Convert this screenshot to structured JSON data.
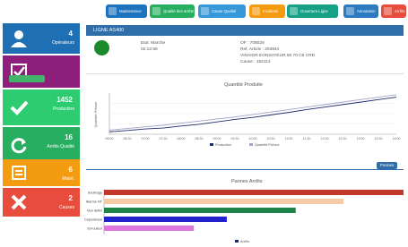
{
  "toolbar": [
    {
      "label": "Maintenance",
      "color": "#1e73be"
    },
    {
      "label": "Qualité des arrêts",
      "color": "#27ae60"
    },
    {
      "label": "Cause Qualité",
      "color": "#3498db"
    },
    {
      "label": "Incidents",
      "color": "#f39c12"
    },
    {
      "label": "Ouverture Ligne",
      "color": "#16a085"
    },
    {
      "label": "Annotation",
      "color": "#2c7bc1"
    },
    {
      "label": "Arrêts",
      "color": "#e74c3c"
    }
  ],
  "sidebar": [
    {
      "value": "4",
      "label": "Opérateurs",
      "icon": "user-icon",
      "color": "#1e6fb3"
    },
    {
      "value": "",
      "label": "",
      "icon": "checklist-icon",
      "color": "#8e1e7c"
    },
    {
      "value": "1452",
      "label": "Production",
      "icon": "check-icon",
      "color": "#2ecc71"
    },
    {
      "value": "16",
      "label": "Arrêts Qualité",
      "icon": "refresh-icon",
      "color": "#27ae60"
    },
    {
      "value": "6",
      "label": "Maint.",
      "icon": "card-icon",
      "color": "#f39c12"
    },
    {
      "value": "2",
      "label": "Causes",
      "icon": "cross-icon",
      "color": "#e74c3c"
    }
  ],
  "header": {
    "title": "LIGNE AS400",
    "status_label": "Etat: Marche",
    "status_time": "02:12:56",
    "of": "OF : 708029",
    "ref": "Ref. Article : 203944",
    "product": "VINAIGR EONSATEUR 50 70 C6 CRD",
    "cause": "Cause : 182113"
  },
  "production_chart": {
    "title": "Quantité Produite",
    "ylabel": "Quantité Prévue",
    "xlabels": [
      "06:00",
      "06:30",
      "07:00",
      "07:30",
      "08:00",
      "08:30",
      "09:00",
      "09:30",
      "10:00",
      "10:30",
      "11:00",
      "11:30",
      "12:00",
      "12:30",
      "13:00",
      "13:30",
      "14:00"
    ],
    "legend": [
      "Production",
      "Quantité Prévue"
    ]
  },
  "chart_data": {
    "type": "bar",
    "title": "Pannes Arrêts",
    "categories": [
      "Soutirage",
      "Alarme NT",
      "Non défini",
      "Capsuleuse",
      "Enrouleur"
    ],
    "values": [
      100,
      80,
      64,
      41,
      30
    ],
    "colors": [
      "#c0392b",
      "#f5cba7",
      "#1e8449",
      "#2222cc",
      "#dd77dd"
    ],
    "legend": [
      "Arrêts"
    ]
  },
  "tab_label": "Pannes"
}
